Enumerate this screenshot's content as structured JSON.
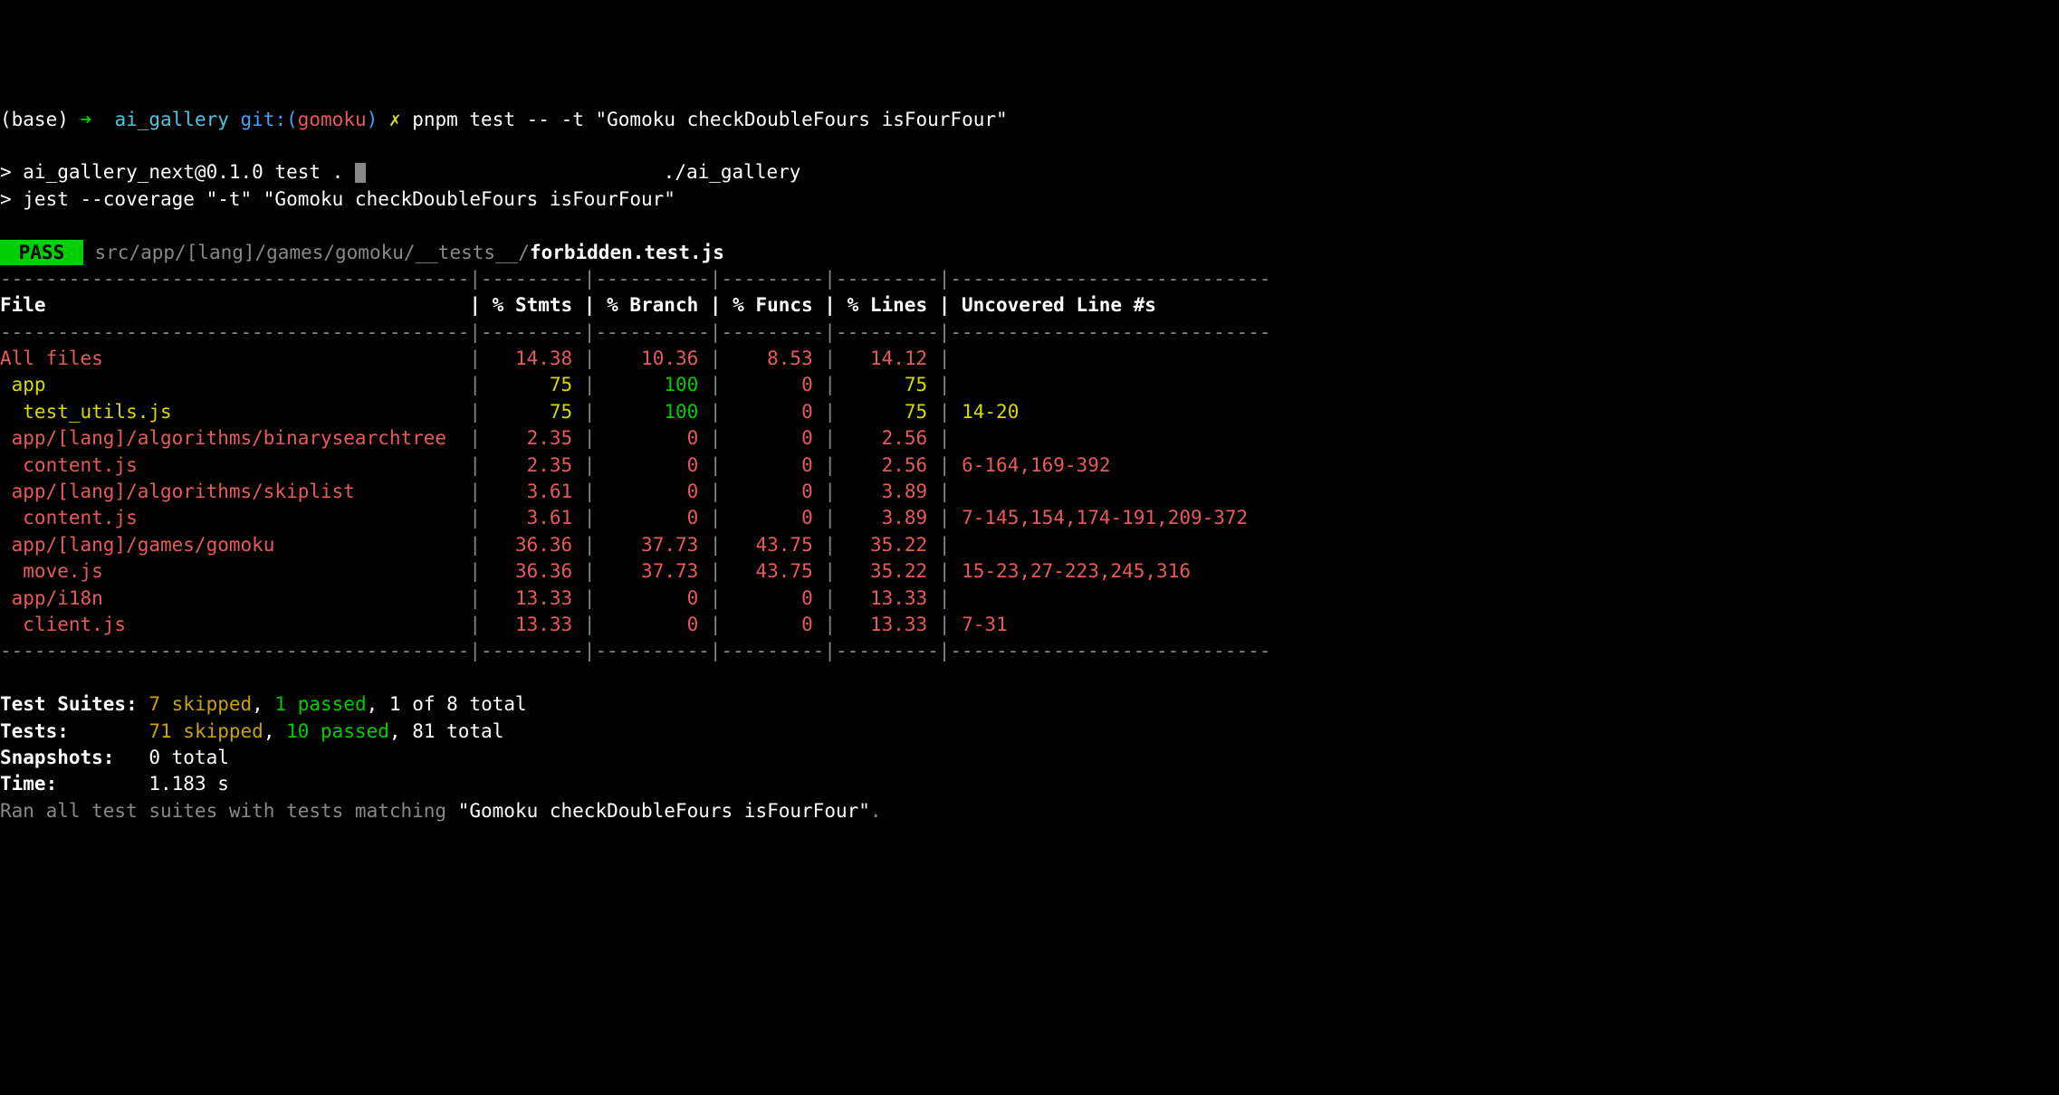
{
  "prompt": {
    "env": "(base)",
    "arrow": "➜",
    "dir": "ai_gallery",
    "git_label": "git:(",
    "branch": "gomoku",
    "git_close": ")",
    "dirty": "✗",
    "command": "pnpm test -- -t \"Gomoku checkDoubleFours isFourFour\""
  },
  "run_lines": {
    "pkg": "> ai_gallery_next@0.1.0 test .",
    "pkg_path": "./ai_gallery",
    "jest": "> jest --coverage \"-t\" \"Gomoku checkDoubleFours isFourFour\""
  },
  "pass": {
    "badge": " PASS ",
    "path_dim": "src/app/[lang]/games/gomoku/__tests__/",
    "path_file": "forbidden.test.js"
  },
  "table_border_top": "-----------------------------------------|---------|----------|---------|---------|----------------------------",
  "table_header": {
    "file": "File",
    "stmts": "% Stmts",
    "branch": "% Branch",
    "funcs": "% Funcs",
    "lines": "% Lines",
    "uncovered": "Uncovered Line #s"
  },
  "table_rows": [
    {
      "file": "All files",
      "indent": 0,
      "stmts": "14.38",
      "s_c": "red",
      "branch": "10.36",
      "b_c": "red",
      "funcs": "8.53",
      "f_c": "red",
      "lines": "14.12",
      "l_c": "red",
      "uncovered": "",
      "row_c": "red"
    },
    {
      "file": "app",
      "indent": 1,
      "stmts": "75",
      "s_c": "yellow",
      "branch": "100",
      "b_c": "green",
      "funcs": "0",
      "f_c": "red",
      "lines": "75",
      "l_c": "yellow",
      "uncovered": "",
      "row_c": "yellow"
    },
    {
      "file": "test_utils.js",
      "indent": 2,
      "stmts": "75",
      "s_c": "yellow",
      "branch": "100",
      "b_c": "green",
      "funcs": "0",
      "f_c": "red",
      "lines": "75",
      "l_c": "yellow",
      "uncovered": "14-20",
      "row_c": "yellow"
    },
    {
      "file": "app/[lang]/algorithms/binarysearchtree",
      "indent": 1,
      "stmts": "2.35",
      "s_c": "red",
      "branch": "0",
      "b_c": "red",
      "funcs": "0",
      "f_c": "red",
      "lines": "2.56",
      "l_c": "red",
      "uncovered": "",
      "row_c": "red"
    },
    {
      "file": "content.js",
      "indent": 2,
      "stmts": "2.35",
      "s_c": "red",
      "branch": "0",
      "b_c": "red",
      "funcs": "0",
      "f_c": "red",
      "lines": "2.56",
      "l_c": "red",
      "uncovered": "6-164,169-392",
      "row_c": "red"
    },
    {
      "file": "app/[lang]/algorithms/skiplist",
      "indent": 1,
      "stmts": "3.61",
      "s_c": "red",
      "branch": "0",
      "b_c": "red",
      "funcs": "0",
      "f_c": "red",
      "lines": "3.89",
      "l_c": "red",
      "uncovered": "",
      "row_c": "red"
    },
    {
      "file": "content.js",
      "indent": 2,
      "stmts": "3.61",
      "s_c": "red",
      "branch": "0",
      "b_c": "red",
      "funcs": "0",
      "f_c": "red",
      "lines": "3.89",
      "l_c": "red",
      "uncovered": "7-145,154,174-191,209-372",
      "row_c": "red"
    },
    {
      "file": "app/[lang]/games/gomoku",
      "indent": 1,
      "stmts": "36.36",
      "s_c": "red",
      "branch": "37.73",
      "b_c": "red",
      "funcs": "43.75",
      "f_c": "red",
      "lines": "35.22",
      "l_c": "red",
      "uncovered": "",
      "row_c": "red"
    },
    {
      "file": "move.js",
      "indent": 2,
      "stmts": "36.36",
      "s_c": "red",
      "branch": "37.73",
      "b_c": "red",
      "funcs": "43.75",
      "f_c": "red",
      "lines": "35.22",
      "l_c": "red",
      "uncovered": "15-23,27-223,245,316",
      "row_c": "red"
    },
    {
      "file": "app/i18n",
      "indent": 1,
      "stmts": "13.33",
      "s_c": "red",
      "branch": "0",
      "b_c": "red",
      "funcs": "0",
      "f_c": "red",
      "lines": "13.33",
      "l_c": "red",
      "uncovered": "",
      "row_c": "red"
    },
    {
      "file": "client.js",
      "indent": 2,
      "stmts": "13.33",
      "s_c": "red",
      "branch": "0",
      "b_c": "red",
      "funcs": "0",
      "f_c": "red",
      "lines": "13.33",
      "l_c": "red",
      "uncovered": "7-31",
      "row_c": "red"
    }
  ],
  "summary": {
    "suites_label": "Test Suites:",
    "suites_skipped": "7 skipped",
    "suites_passed": "1 passed",
    "suites_total": "1 of 8 total",
    "tests_label": "Tests:",
    "tests_skipped": "71 skipped",
    "tests_passed": "10 passed",
    "tests_total": "81 total",
    "snapshots_label": "Snapshots:",
    "snapshots_value": "0 total",
    "time_label": "Time:",
    "time_value": "1.183 s",
    "ran_line_prefix": "Ran all test suites with tests matching ",
    "ran_line_match": "\"Gomoku checkDoubleFours isFourFour\"",
    "ran_line_suffix": "."
  },
  "col_widths": {
    "file": 41,
    "stmts": 9,
    "branch": 10,
    "funcs": 9,
    "lines": 9
  }
}
